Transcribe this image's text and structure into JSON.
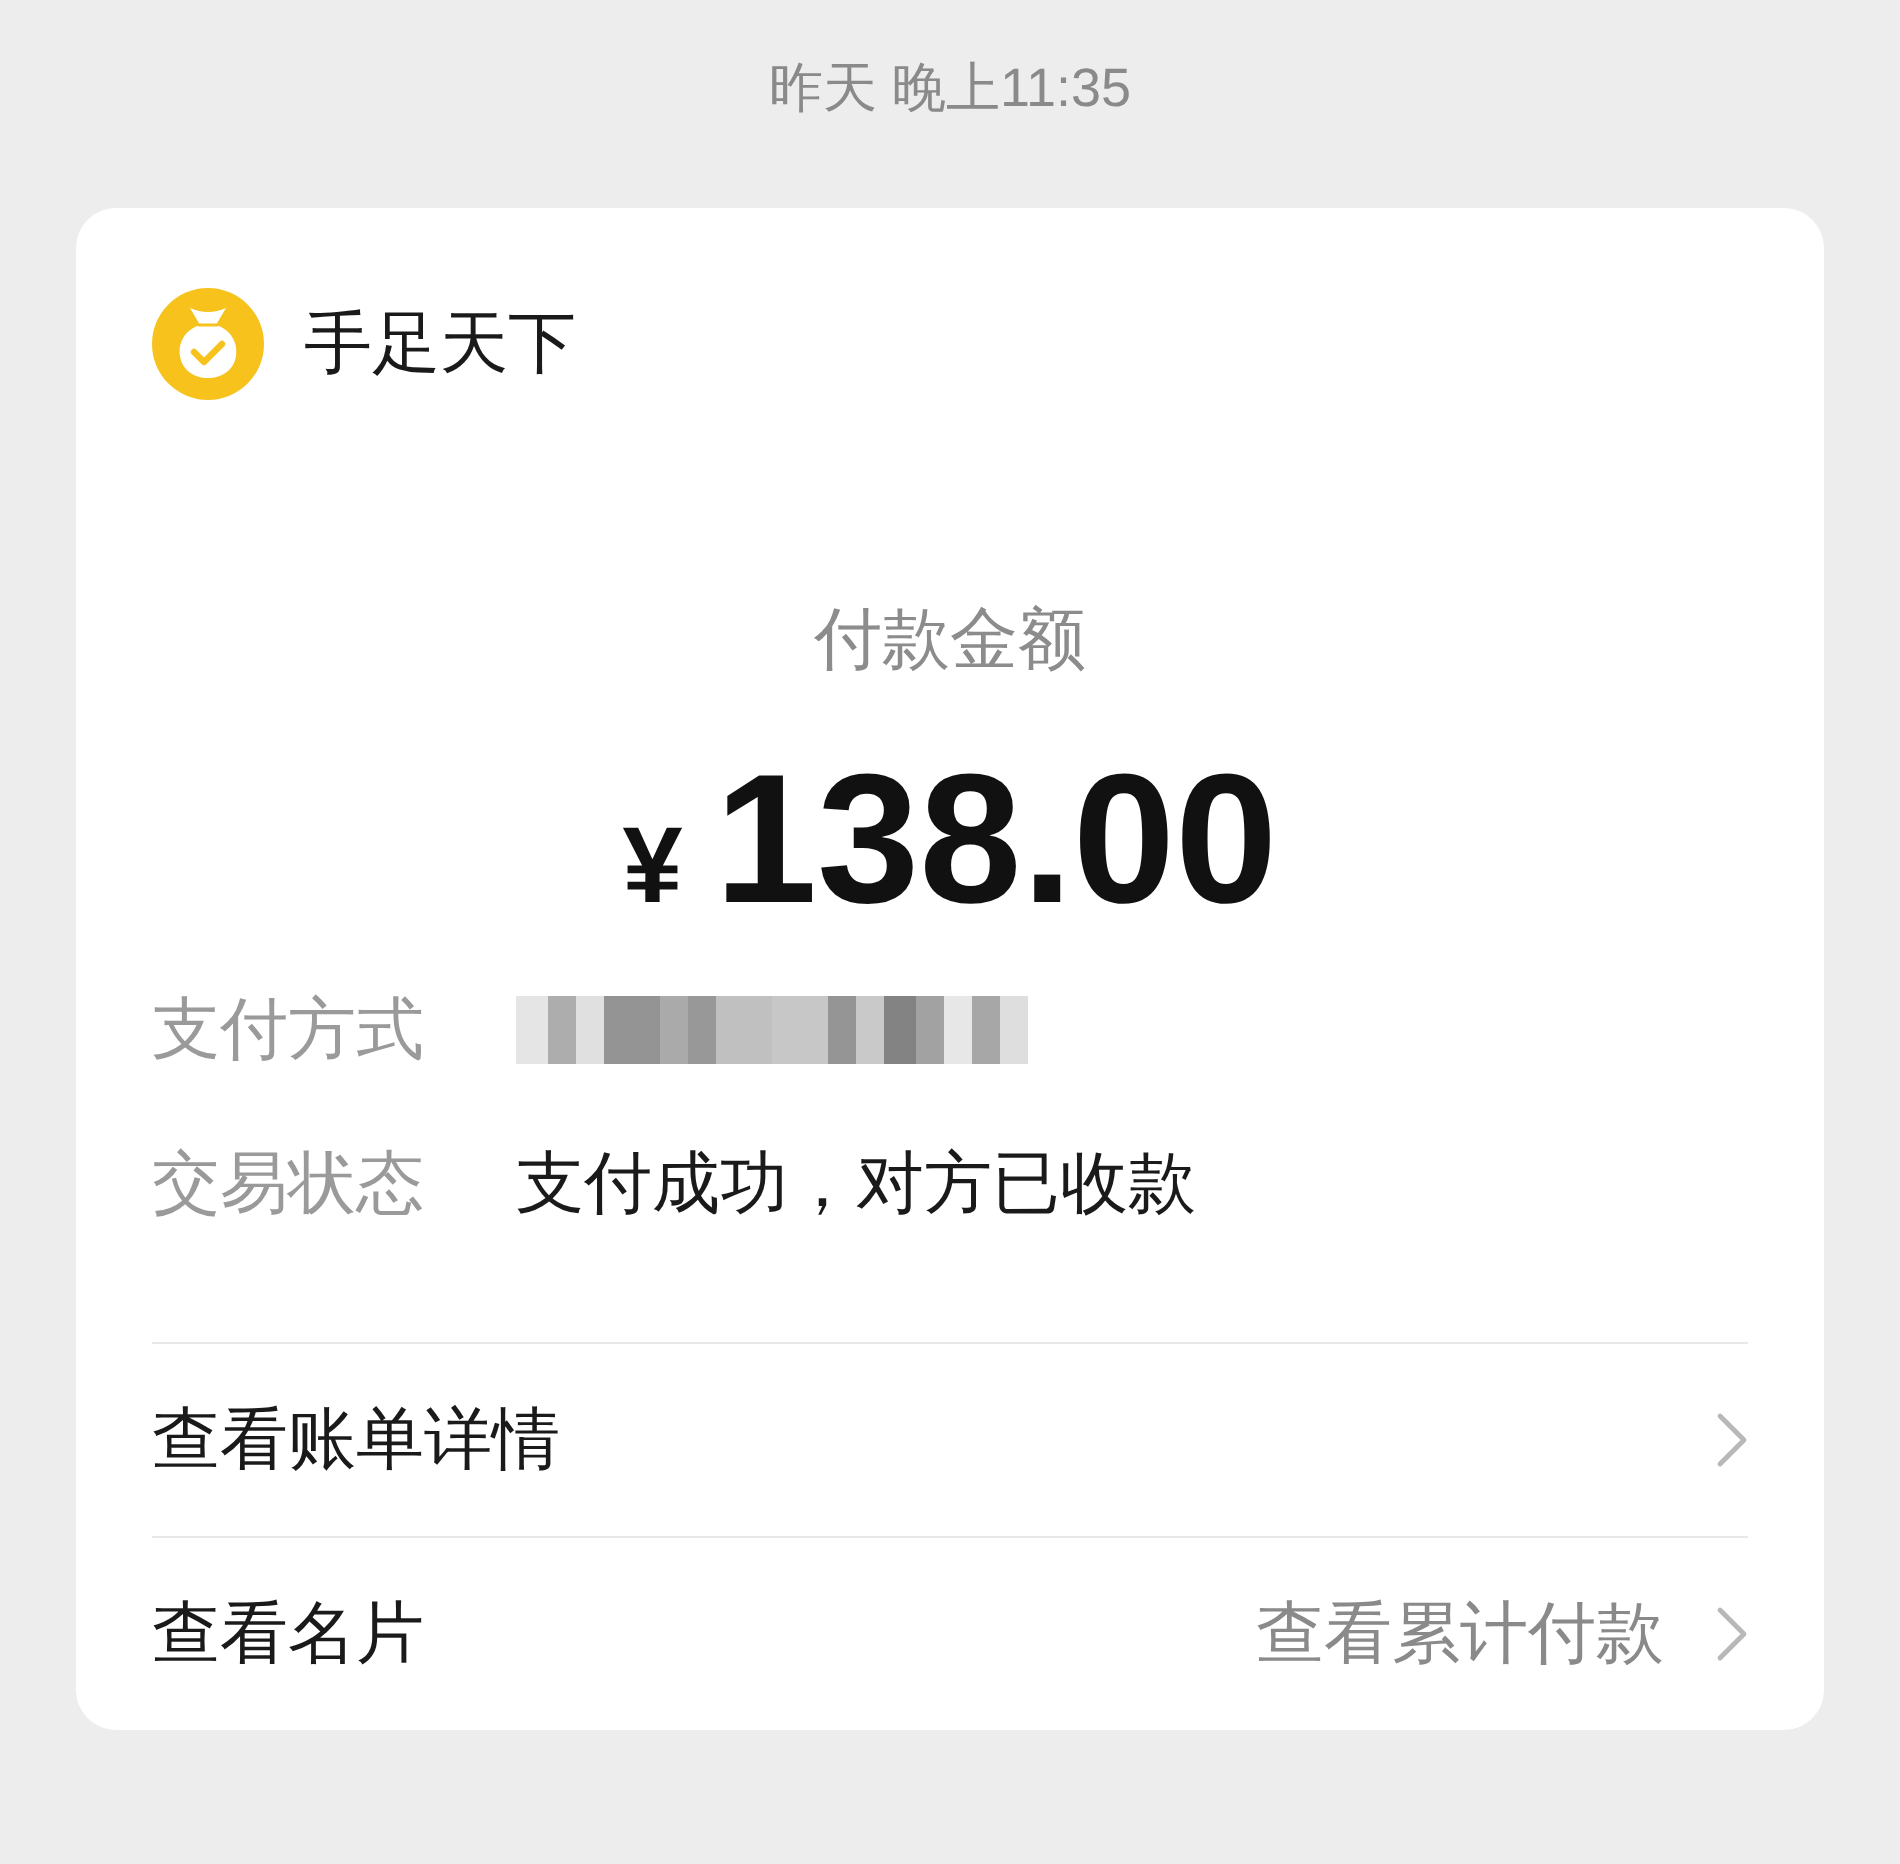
{
  "timestamp": "昨天 晚上11:35",
  "merchant": {
    "name": "手足天下"
  },
  "amount": {
    "label": "付款金额",
    "currency": "¥",
    "value": "138.00"
  },
  "details": [
    {
      "label": "支付方式",
      "kind": "redacted"
    },
    {
      "label": "交易状态",
      "kind": "text",
      "value": "支付成功，对方已收款"
    }
  ],
  "links": [
    {
      "label": "查看账单详情"
    },
    {
      "label": "查看名片",
      "value": "查看累计付款"
    }
  ]
}
